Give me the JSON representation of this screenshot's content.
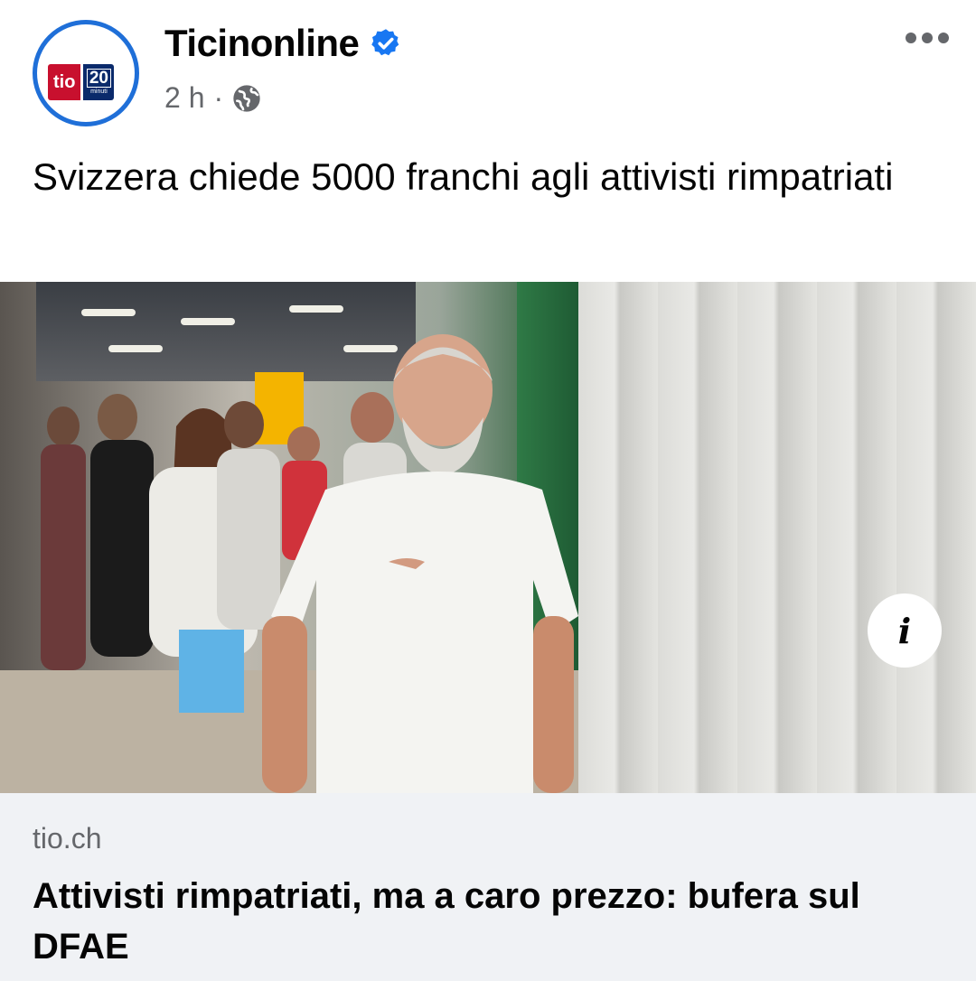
{
  "post": {
    "page_name": "Ticinonline",
    "time": "2 h",
    "separator": "·",
    "privacy_icon": "globe-icon",
    "verified_icon": "verified-badge-icon",
    "more_icon": "more-options-icon",
    "text": "Svizzera chiede 5000 franchi agli attivisti rimpatriati"
  },
  "avatar": {
    "logo_left": "tio",
    "logo_num": "20",
    "logo_sub": "minuti"
  },
  "photo": {
    "info_label": "i",
    "info_icon": "info-icon"
  },
  "link_preview": {
    "domain": "tio.ch",
    "title": "Attivisti rimpatriati, ma a caro prezzo: bufera sul DFAE"
  },
  "colors": {
    "verified_blue": "#1877f2",
    "avatar_ring": "#1f6fd8",
    "logo_red": "#c8102e",
    "logo_navy": "#0a2a6b",
    "secondary_text": "#65676b",
    "preview_bg": "#f0f2f5"
  }
}
